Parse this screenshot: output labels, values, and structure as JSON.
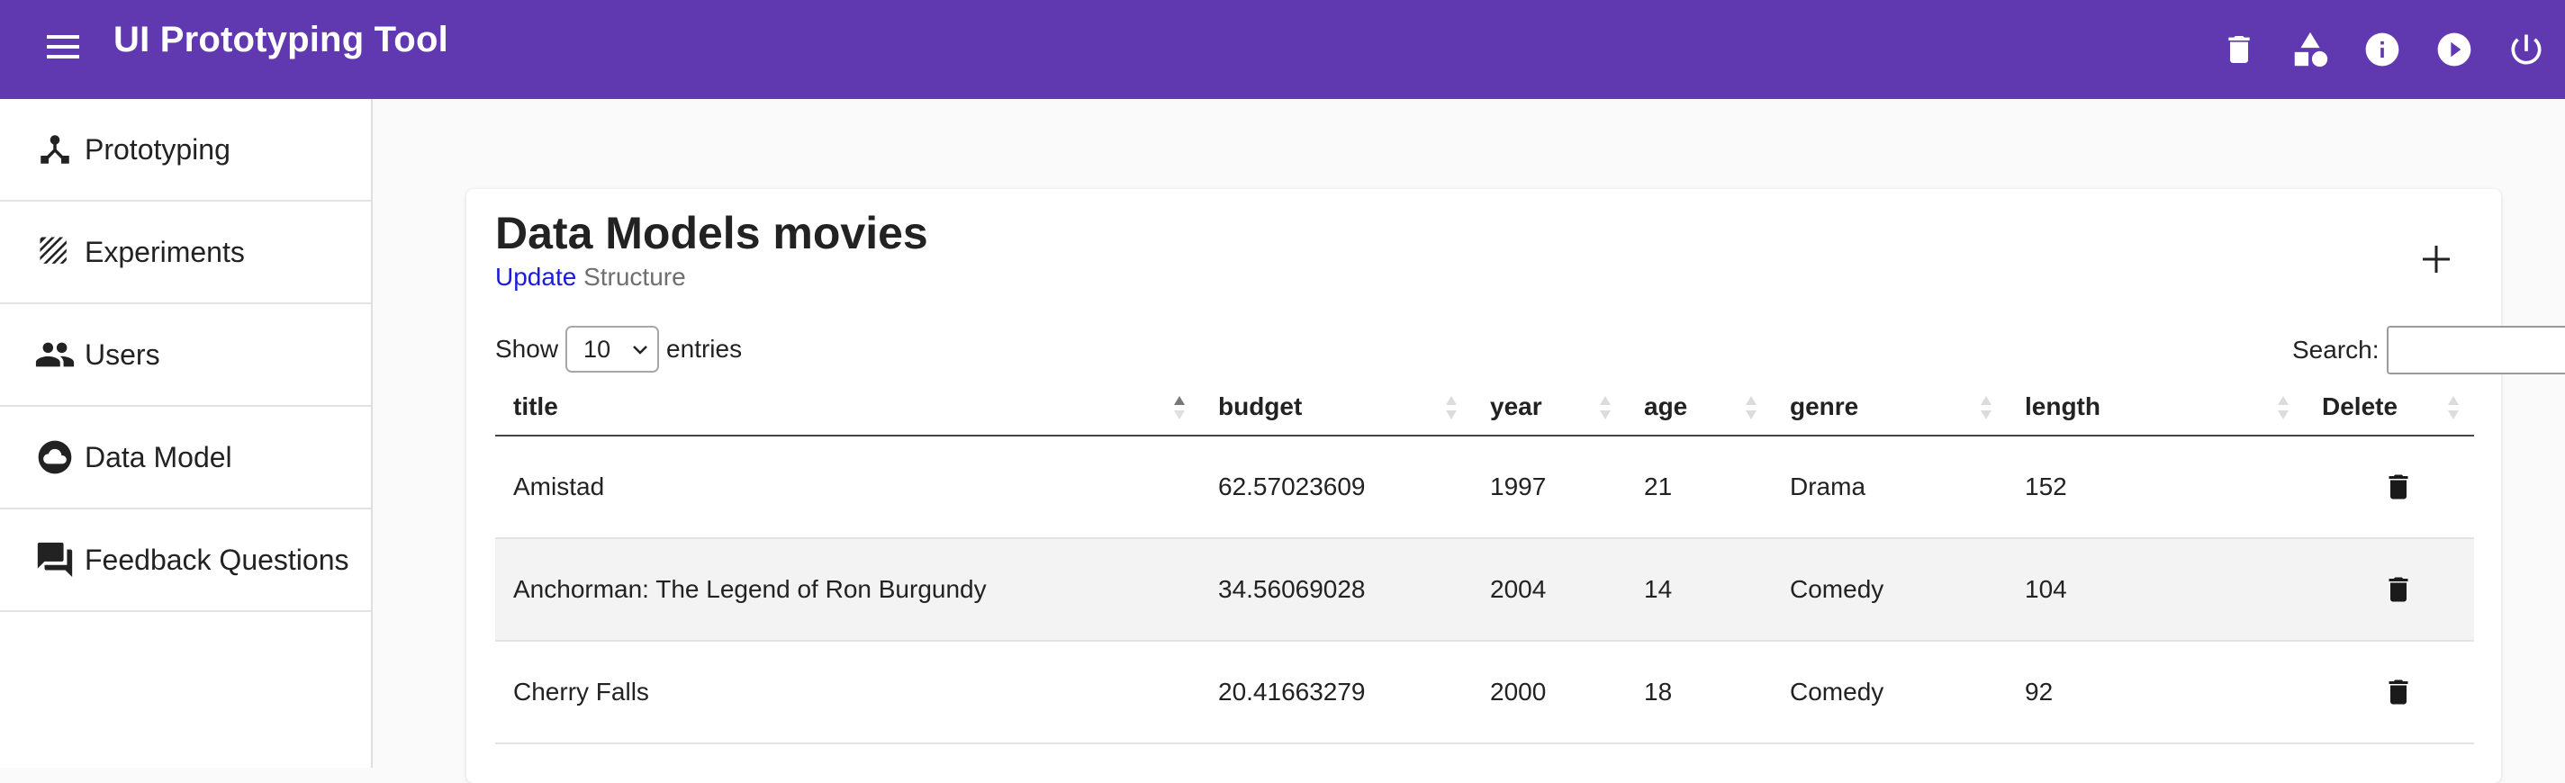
{
  "app": {
    "title": "UI Prototyping Tool",
    "bar_color": "#6039b0",
    "top_icons": [
      "trash-icon",
      "shapes-icon",
      "info-icon",
      "play-icon",
      "power-icon"
    ]
  },
  "sidebar": {
    "items": [
      {
        "label": "Prototyping",
        "icon": "prototyping-icon"
      },
      {
        "label": "Experiments",
        "icon": "experiments-icon"
      },
      {
        "label": "Users",
        "icon": "users-icon"
      },
      {
        "label": "Data Model",
        "icon": "cloud-icon"
      },
      {
        "label": "Feedback Questions",
        "icon": "forum-icon"
      }
    ]
  },
  "main": {
    "title": "Data Models movies",
    "update_link": "Update",
    "structure_link": "Structure",
    "show_label": "Show",
    "page_length": "10",
    "entries_label": "entries",
    "search_label": "Search:",
    "search_value": "",
    "columns": [
      "title",
      "budget",
      "year",
      "age",
      "genre",
      "length",
      "Delete"
    ],
    "rows": [
      {
        "title": "Amistad",
        "budget": "62.57023609",
        "year": "1997",
        "age": "21",
        "genre": "Drama",
        "length": "152"
      },
      {
        "title": "Anchorman: The Legend of Ron Burgundy",
        "budget": "34.56069028",
        "year": "2004",
        "age": "14",
        "genre": "Comedy",
        "length": "104"
      },
      {
        "title": "Cherry Falls",
        "budget": "20.41663279",
        "year": "2000",
        "age": "18",
        "genre": "Comedy",
        "length": "92"
      }
    ]
  }
}
